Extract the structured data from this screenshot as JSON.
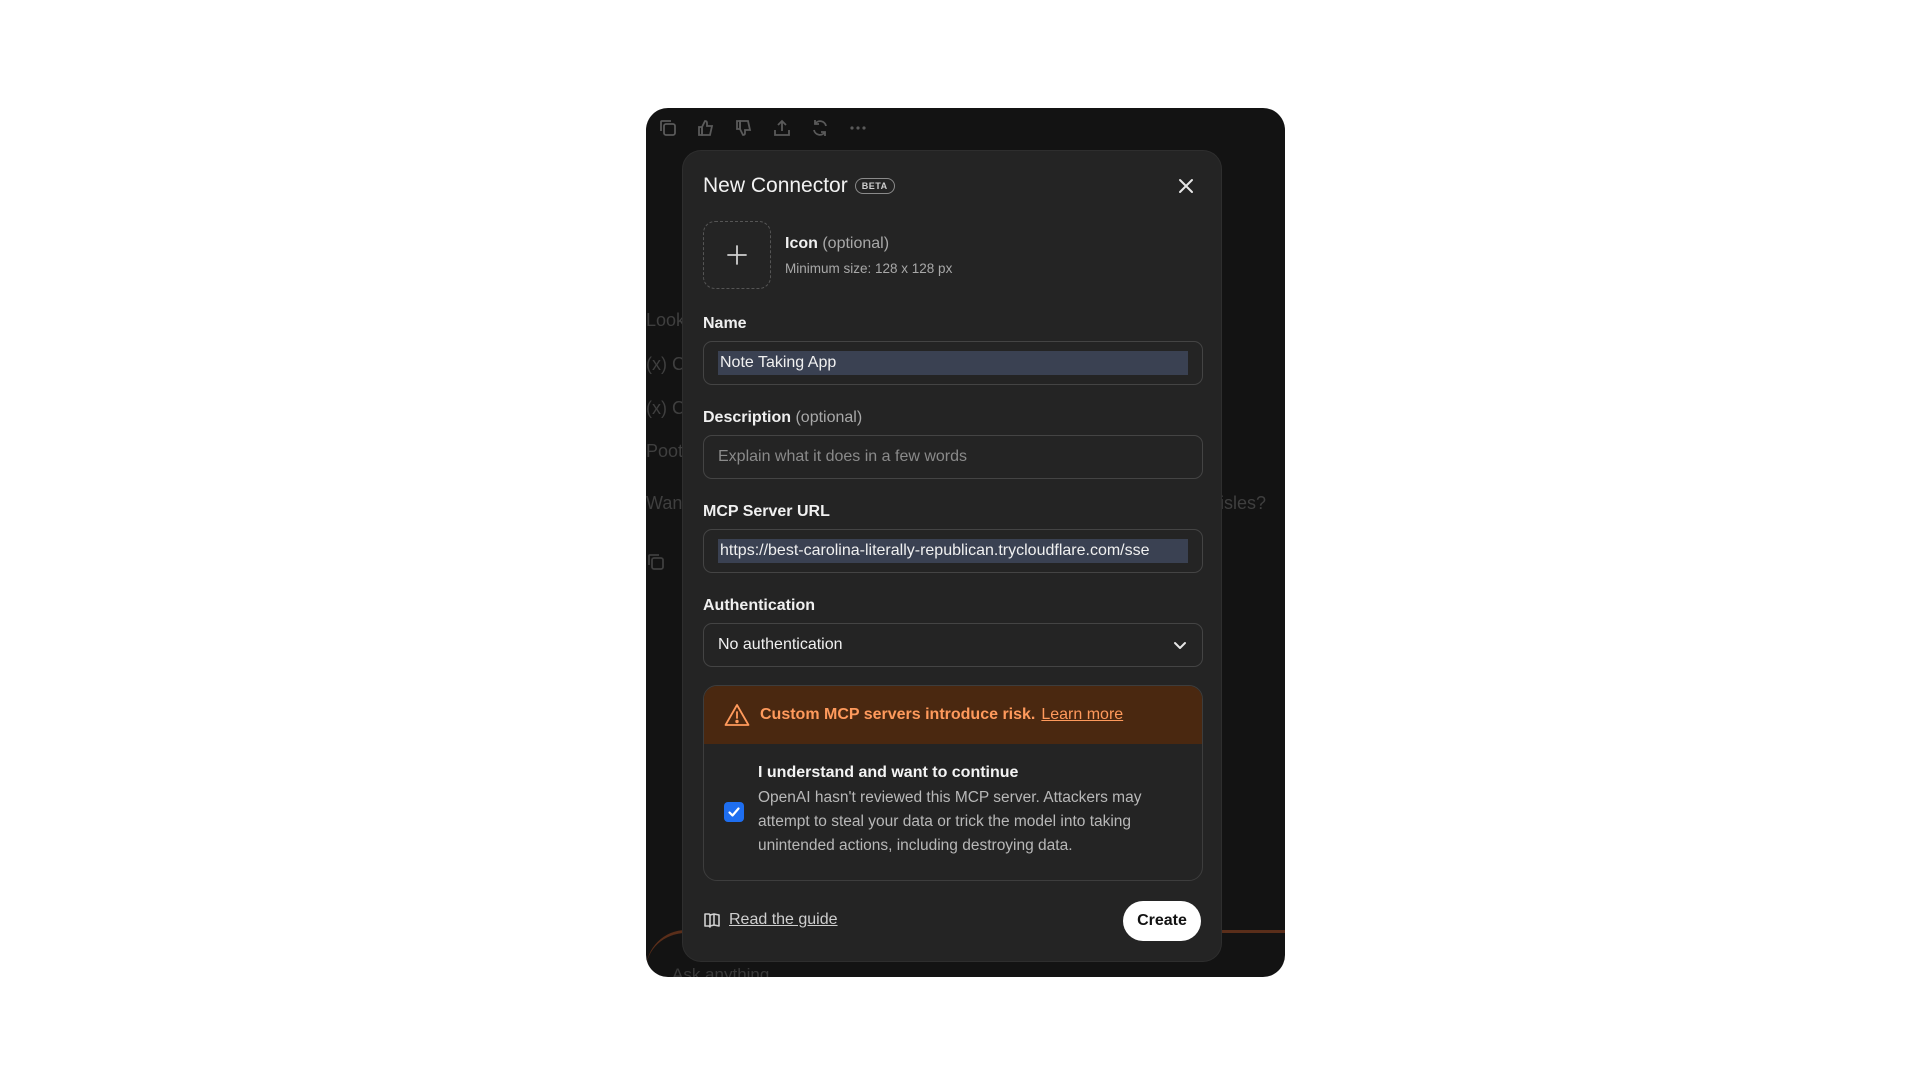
{
  "background": {
    "lines": [
      "Look",
      "(x) C",
      "(x) C",
      "Poot",
      "Wan",
      "isles?"
    ],
    "composer_placeholder": "Ask anything"
  },
  "modal": {
    "title": "New Connector",
    "badge": "BETA",
    "icon_label": "Icon",
    "icon_optional": "(optional)",
    "icon_hint": "Minimum size: 128 x 128 px",
    "name_label": "Name",
    "name_value": "Note Taking App",
    "description_label": "Description",
    "description_optional": "(optional)",
    "description_placeholder": "Explain what it does in a few words",
    "url_label": "MCP Server URL",
    "url_value": "https://best-carolina-literally-republican.trycloudflare.com/sse",
    "auth_label": "Authentication",
    "auth_value": "No authentication",
    "warning_text": "Custom MCP servers introduce risk.",
    "warning_link": "Learn more",
    "consent_title": "I understand and want to continue",
    "consent_text": "OpenAI hasn't reviewed this MCP server. Attackers may attempt to steal your data or trick the model into taking unintended actions, including destroying data.",
    "consent_checked": true,
    "guide_link": "Read the guide",
    "create_label": "Create"
  },
  "colors": {
    "accent": "#1e6ef0",
    "warning": "#ff9a5c",
    "warning_bg": "#4a2810"
  }
}
